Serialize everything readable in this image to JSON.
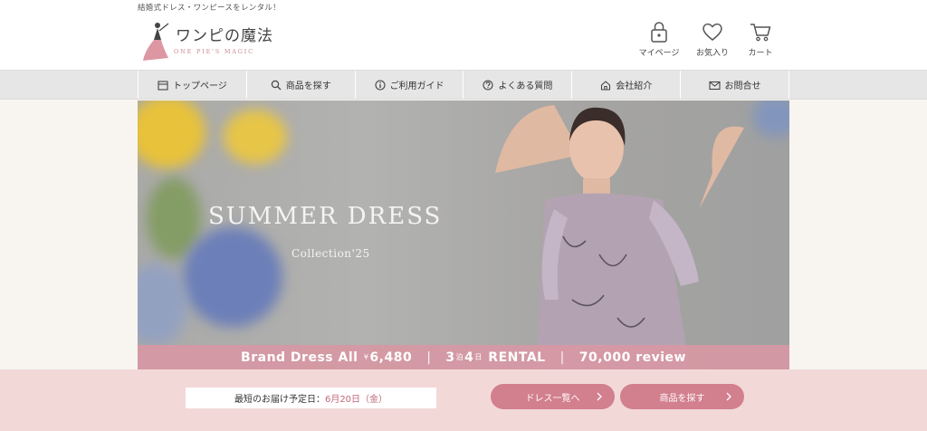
{
  "header": {
    "tagline": "結婚式ドレス・ワンピースをレンタル！",
    "logo_text": "ワンピの魔法",
    "logo_sub": "ONE PIE'S MAGIC",
    "utility": [
      {
        "label": "マイページ",
        "icon": "lock-icon"
      },
      {
        "label": "お気入り",
        "icon": "heart-icon"
      },
      {
        "label": "カート",
        "icon": "cart-icon"
      }
    ]
  },
  "nav": {
    "items": [
      {
        "label": "トップページ",
        "icon": "calendar-icon"
      },
      {
        "label": "商品を探す",
        "icon": "search-icon"
      },
      {
        "label": "ご利用ガイド",
        "icon": "info-icon"
      },
      {
        "label": "よくある質問",
        "icon": "question-icon"
      },
      {
        "label": "会社紹介",
        "icon": "home-icon"
      },
      {
        "label": "お問合せ",
        "icon": "mail-icon"
      }
    ]
  },
  "hero": {
    "title": "SUMMER DRESS",
    "subtitle": "Collection'25",
    "banner": {
      "brand_label": "Brand Dress All",
      "price_prefix": "¥",
      "price": "6,480",
      "nights": "3",
      "nights_unit": "泊",
      "days": "4",
      "days_unit": "日",
      "rental": "RENTAL",
      "review": "70,000 review"
    }
  },
  "footer": {
    "delivery_label": "最短のお届け予定日：",
    "delivery_date": "6月20日（金）",
    "btn_dress_list": "ドレス一覧へ",
    "btn_search": "商品を探す"
  },
  "colors": {
    "accent": "#d27f8e",
    "banner": "#d698a4",
    "footer_bg": "#f2d9d8",
    "nav_bg": "#e6e6e6"
  }
}
